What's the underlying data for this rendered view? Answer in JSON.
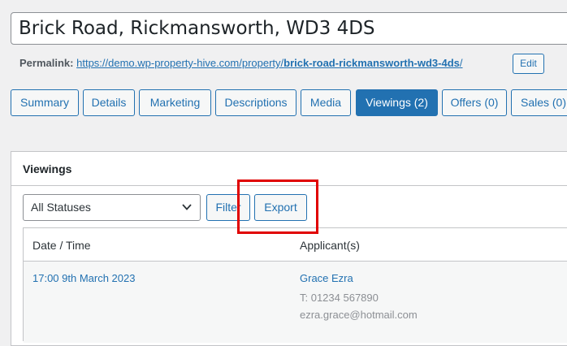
{
  "post": {
    "title": "Brick Road, Rickmansworth, WD3 4DS",
    "permalink_label": "Permalink:",
    "permalink_base": "https://demo.wp-property-hive.com/property/",
    "permalink_slug": "brick-road-rickmansworth-wd3-4ds",
    "permalink_trailing": "/",
    "edit_label": "Edit"
  },
  "tabs": [
    {
      "label": "Summary"
    },
    {
      "label": "Details"
    },
    {
      "label": "Marketing"
    },
    {
      "label": "Descriptions"
    },
    {
      "label": "Media"
    },
    {
      "label": "Viewings (2)",
      "active": true
    },
    {
      "label": "Offers (0)"
    },
    {
      "label": "Sales (0)"
    }
  ],
  "viewings": {
    "heading": "Viewings",
    "status_filter": {
      "selected": "All Statuses"
    },
    "filter_label": "Filter",
    "export_label": "Export",
    "columns": [
      "Date / Time",
      "Applicant(s)"
    ],
    "rows": [
      {
        "datetime": "17:00 9th March 2023",
        "applicant_name": "Grace Ezra",
        "phone": "T: 01234 567890",
        "email": "ezra.grace@hotmail.com"
      }
    ]
  },
  "colors": {
    "accent": "#2271b1",
    "highlight": "#e00000"
  }
}
